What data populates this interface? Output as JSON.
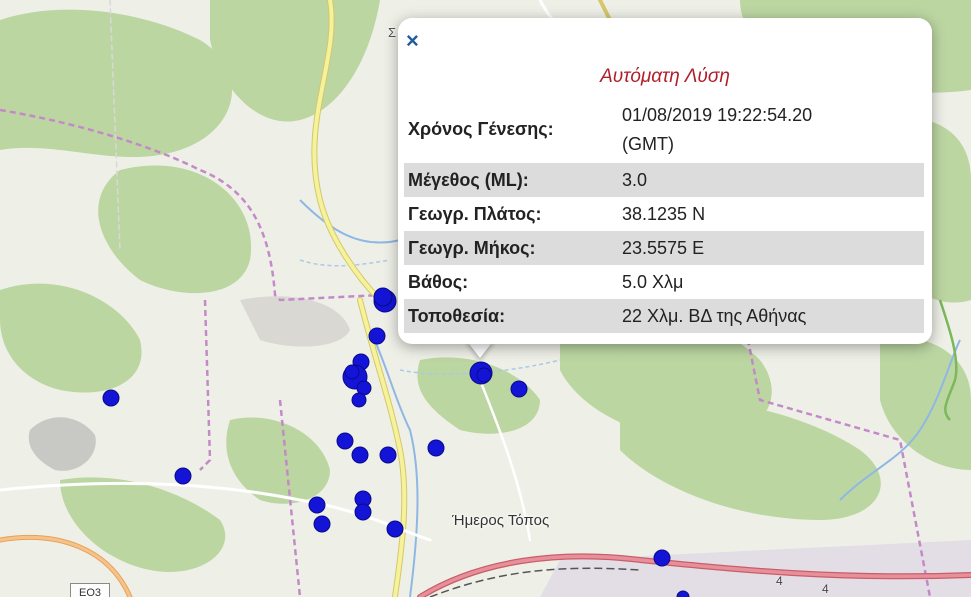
{
  "map": {
    "place_label": "Ήμερος Τόπος",
    "road_shield": "ΕΟ3",
    "road_numbers": [
      "4",
      "4"
    ],
    "top_label": "Σ",
    "marker_color": "#1414d6",
    "colors": {
      "forest": "#b8d4a0",
      "land": "#eef0e8",
      "road_major": "#f4f29a",
      "boundary": "#c48ac8",
      "river": "#9ec3ea",
      "water_dashed": "#a9c9e8"
    },
    "earthquake_count": 28
  },
  "popup": {
    "close_symbol": "×",
    "title": "Αυτόματη Λύση",
    "rows": [
      {
        "key": "Χρόνος Γένεσης:",
        "value_line1": "01/08/2019 19:22:54.20",
        "value_line2": "(GMT)"
      },
      {
        "key": "Μέγεθος (ML):",
        "value": "3.0"
      },
      {
        "key": "Γεωγρ. Πλάτος:",
        "value": "38.1235 N"
      },
      {
        "key": "Γεωγρ. Μήκος:",
        "value": "23.5575 E"
      },
      {
        "key": "Βάθος:",
        "value": "5.0 Χλμ"
      },
      {
        "key": "Τοποθεσία:",
        "value": "22 Χλμ. ΒΔ της Αθήνας"
      }
    ]
  }
}
